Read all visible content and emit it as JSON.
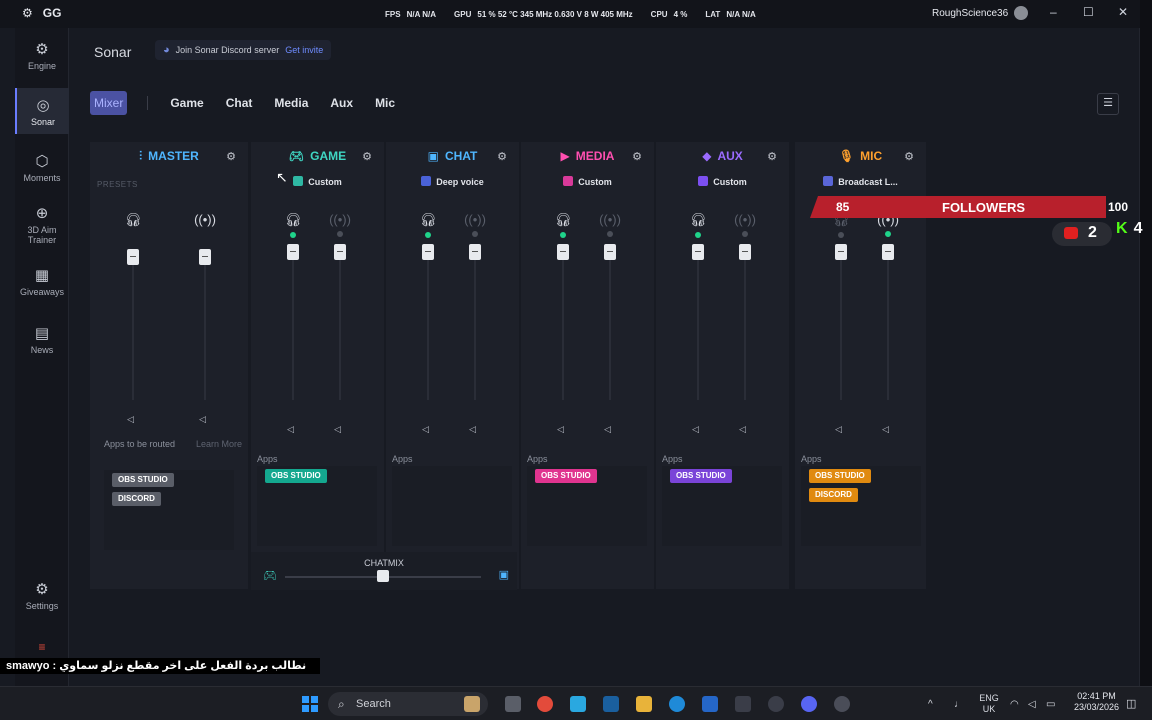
{
  "titlebar": {
    "logo": "GG",
    "stats": [
      {
        "label": "FPS",
        "value": "N/A  N/A"
      },
      {
        "label": "GPU",
        "value": "51 %  52 °C  345 MHz  0.630 V  8 W  405 MHz"
      },
      {
        "label": "CPU",
        "value": "4 %"
      },
      {
        "label": "LAT",
        "value": "N/A  N/A"
      }
    ],
    "username": "RoughScience36"
  },
  "sidebar": {
    "items": [
      {
        "label": "Engine",
        "icon": "engine-icon"
      },
      {
        "label": "Sonar",
        "icon": "sonar-icon",
        "active": true
      },
      {
        "label": "Moments",
        "icon": "moments-icon"
      },
      {
        "label": "3D Aim Trainer",
        "icon": "aim-icon"
      },
      {
        "label": "Giveaways",
        "icon": "gift-icon"
      },
      {
        "label": "News",
        "icon": "news-icon"
      },
      {
        "label": "Settings",
        "icon": "gear-icon"
      }
    ]
  },
  "header": {
    "title": "Sonar",
    "discord_text": "Join Sonar Discord server",
    "discord_link": "Get invite"
  },
  "tabs": [
    "Mixer",
    "Game",
    "Chat",
    "Media",
    "Aux",
    "Mic"
  ],
  "mixer": {
    "presets_label": "PRESETS",
    "master": {
      "name": "MASTER",
      "color": "#4fb6ff",
      "note": "Apps to be routed",
      "learn": "Learn More",
      "apps": [
        "OBS STUDIO",
        "DISCORD"
      ]
    },
    "channels": [
      {
        "name": "GAME",
        "color": "#3fd6c3",
        "preset": "Custom",
        "preset_color": "#2fb8a4",
        "apps_label": "Apps",
        "apps": [
          "OBS STUDIO"
        ],
        "badge_color": "#14a88f"
      },
      {
        "name": "CHAT",
        "color": "#4fb6ff",
        "preset": "Deep voice",
        "preset_color": "#4a62d8",
        "apps_label": "Apps",
        "apps": [],
        "badge_color": "#2f79c7"
      },
      {
        "name": "MEDIA",
        "color": "#ff4fb0",
        "preset": "Custom",
        "preset_color": "#d93a9a",
        "apps_label": "Apps",
        "apps": [
          "OBS STUDIO"
        ],
        "badge_color": "#e0348f"
      },
      {
        "name": "AUX",
        "color": "#9b6bff",
        "preset": "Custom",
        "preset_color": "#7c4ff0",
        "apps_label": "Apps",
        "apps": [
          "OBS STUDIO"
        ],
        "badge_color": "#7a44d8"
      },
      {
        "name": "MIC",
        "color": "#ffa12e",
        "preset": "Broadcast L...",
        "preset_color": "#5a66d8",
        "apps_label": "Apps",
        "apps": [
          "OBS STUDIO",
          "DISCORD"
        ],
        "badge_color": "#e08a10"
      }
    ],
    "chatmix_label": "CHATMIX"
  },
  "overlay": {
    "followers_current": "85",
    "followers_label": "FOLLOWERS",
    "followers_goal": "100",
    "youtube_count": "2",
    "kick_count": "4"
  },
  "subtitle_text": "smawyo :  نطالب بردة الفعل على اخر مقطع نزلو سماوي",
  "taskbar": {
    "search": "Search",
    "lang_top": "ENG",
    "lang_bottom": "UK",
    "time": "02:41 PM",
    "date": "23/03/2026"
  }
}
